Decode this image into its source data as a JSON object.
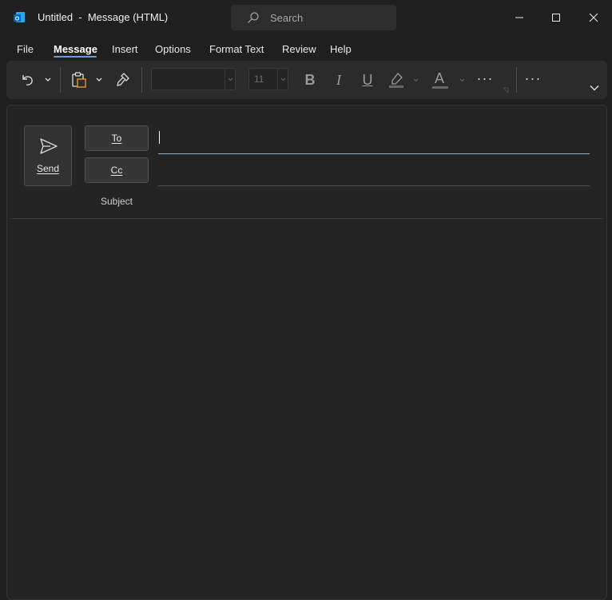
{
  "window": {
    "title": "Untitled  -  Message (HTML)",
    "app_icon": "outlook-icon",
    "search_placeholder": "Search",
    "controls": [
      "minimize-icon",
      "maximize-icon",
      "close-icon"
    ]
  },
  "menu": {
    "items": [
      "File",
      "Message",
      "Insert",
      "Options",
      "Format Text",
      "Review",
      "Help"
    ],
    "active": "Message"
  },
  "ribbon": {
    "font_name": "",
    "font_size": "11",
    "icons": [
      "undo-icon",
      "paste-icon",
      "format-painter-icon",
      "bold-icon",
      "italic-icon",
      "underline-icon",
      "highlight-icon",
      "font-color-icon",
      "more-icon",
      "expand-ribbon-icon"
    ],
    "bold_glyph": "B",
    "italic_glyph": "I",
    "underline_glyph": "U",
    "font_color_glyph": "A",
    "more_glyph": "···"
  },
  "compose": {
    "send_label": "Send",
    "to_label": "To",
    "cc_label": "Cc",
    "subject_label": "Subject",
    "to_value": "",
    "cc_value": "",
    "subject_value": ""
  },
  "colors": {
    "accent": "#5ea0e6",
    "background": "#1f1f1f",
    "ribbon": "#2b2b2b",
    "compose": "#242424"
  }
}
